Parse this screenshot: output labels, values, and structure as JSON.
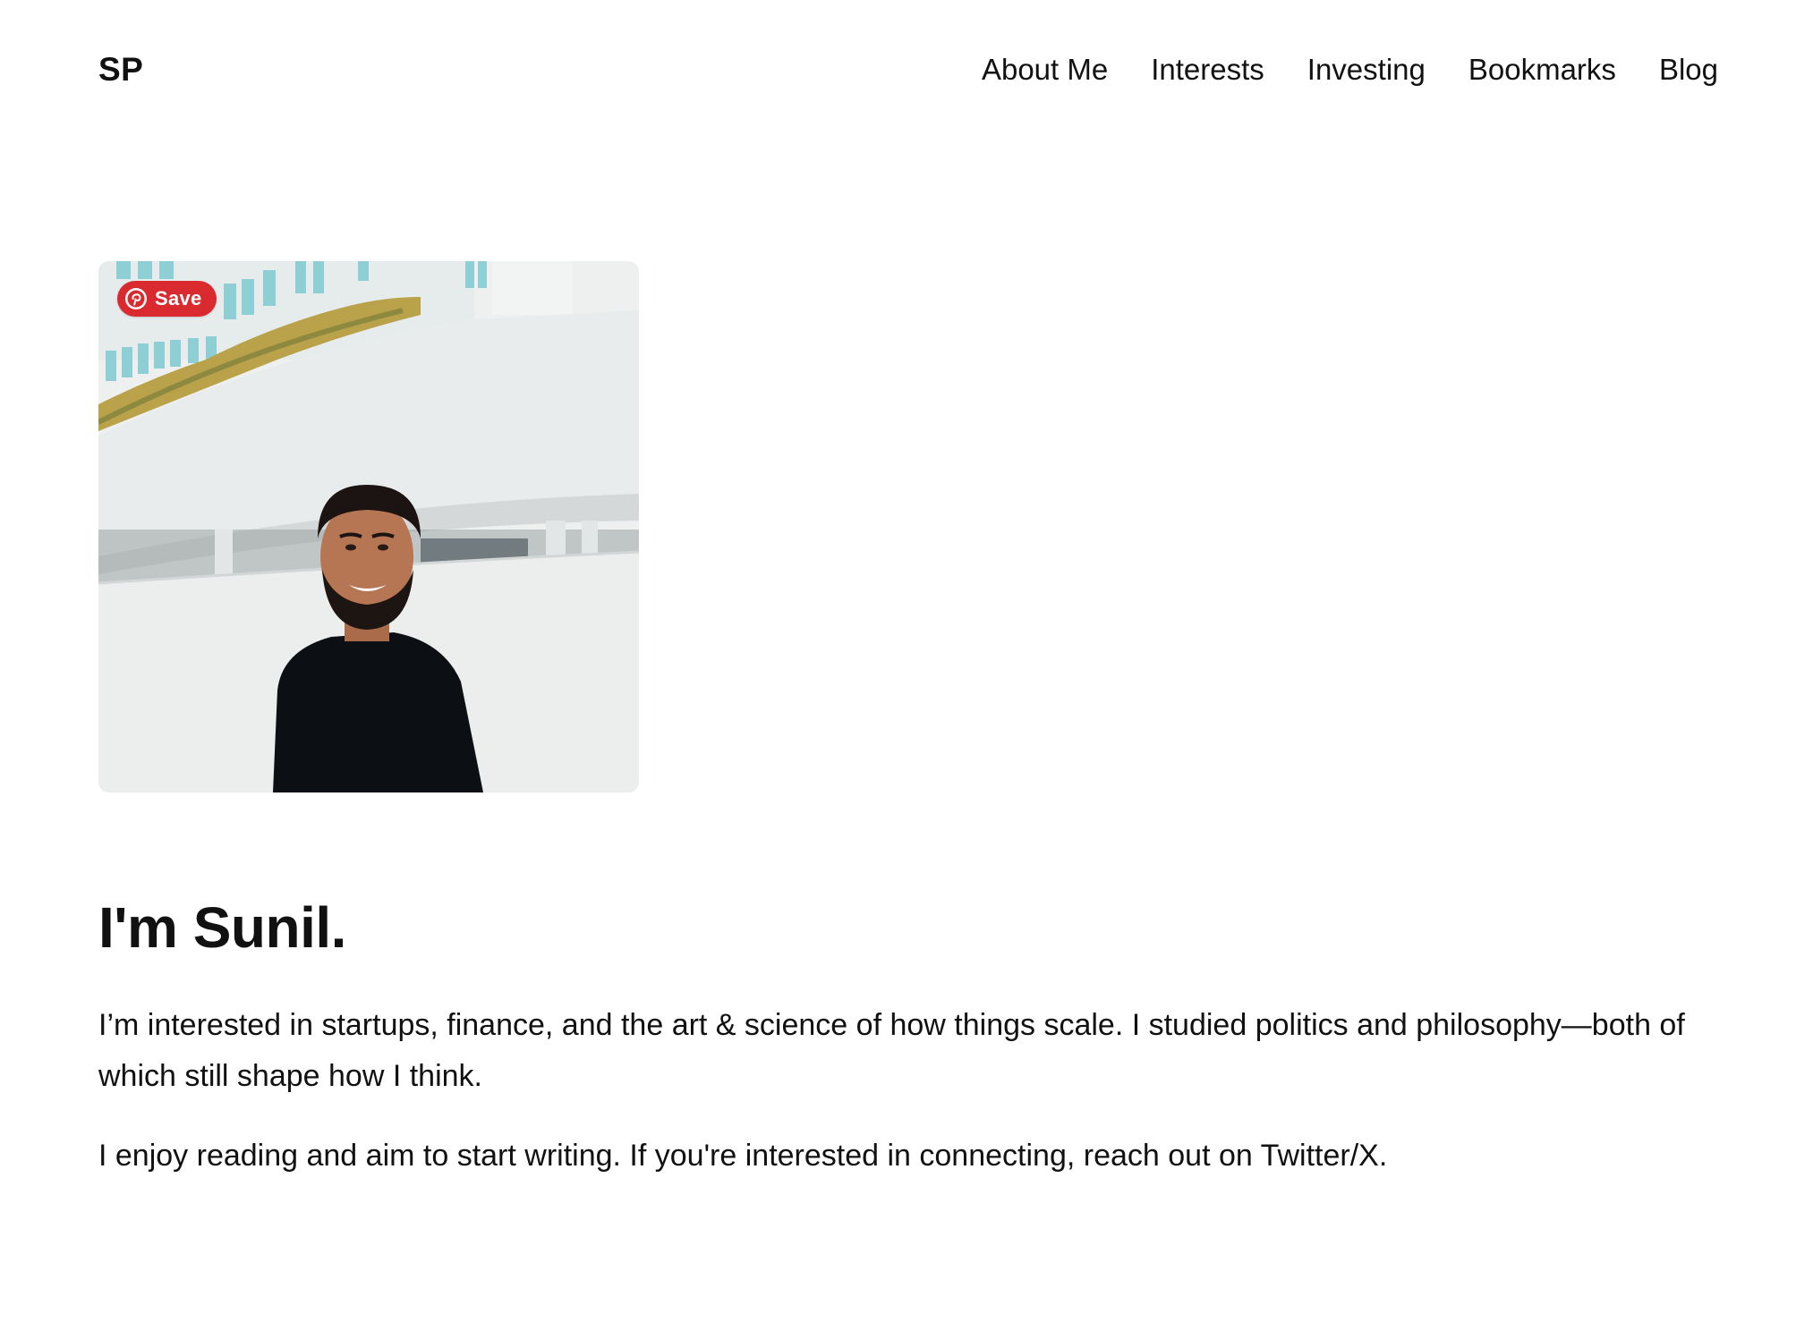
{
  "header": {
    "logo": "SP",
    "nav": [
      {
        "label": "About Me"
      },
      {
        "label": "Interests"
      },
      {
        "label": "Investing"
      },
      {
        "label": "Bookmarks"
      },
      {
        "label": "Blog"
      }
    ]
  },
  "hero": {
    "save_button": {
      "label": "Save",
      "icon": "pinterest-icon",
      "color": "#d92b2f"
    }
  },
  "content": {
    "headline": "I'm Sunil.",
    "paragraph_1": "I’m interested in startups, finance, and the art & science of how things scale. I studied politics and philosophy—both of which still shape how I think.",
    "paragraph_2": "I enjoy reading and aim to start writing. If you're interested in connecting, reach out on Twitter/X."
  }
}
